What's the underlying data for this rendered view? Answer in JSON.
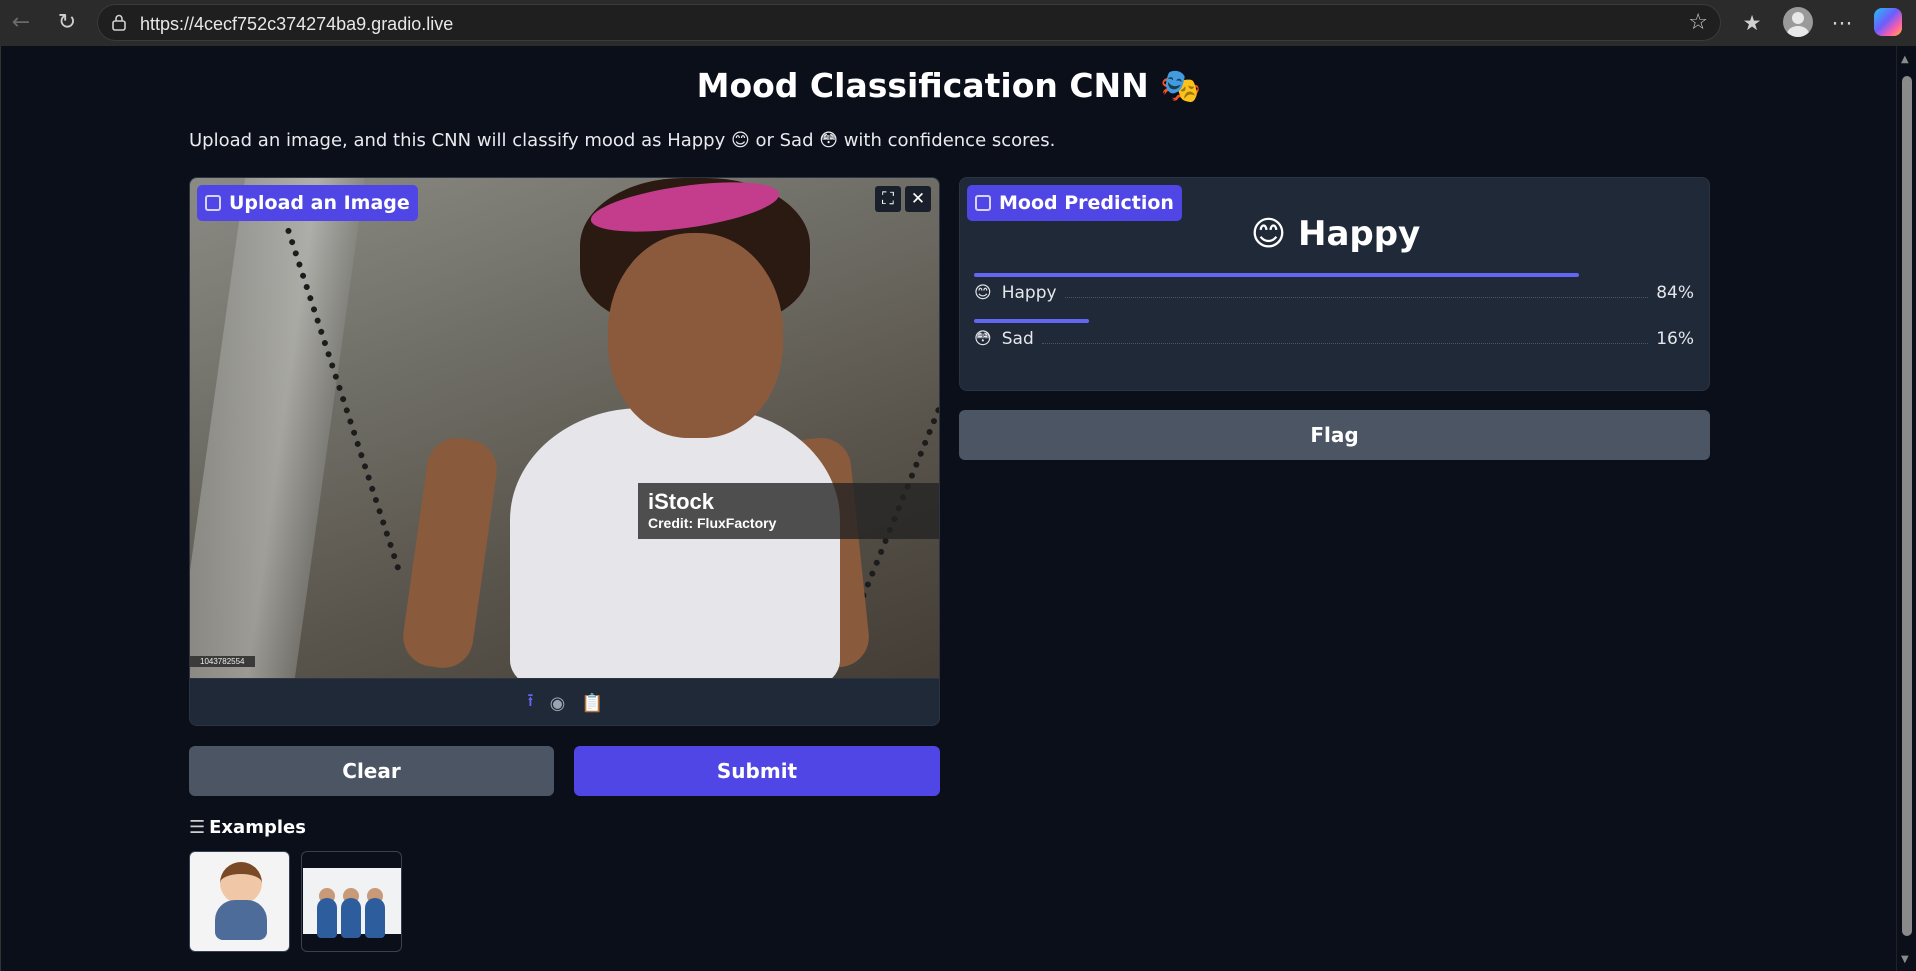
{
  "browser": {
    "url": "https://4cecf752c374274ba9.gradio.live",
    "back_icon": "arrow-left-icon",
    "reload_icon": "reload-icon"
  },
  "page": {
    "title": "Mood Classification CNN 🎭",
    "description": "Upload an image, and this CNN will classify mood as Happy 😊 or Sad 😳 with confidence scores."
  },
  "input": {
    "label": "Upload an Image",
    "watermark_brand": "iStock",
    "watermark_credit": "Credit: FluxFactory",
    "image_id": "1043782554",
    "source_icons": [
      "upload-icon",
      "webcam-icon",
      "clipboard-icon"
    ]
  },
  "buttons": {
    "clear": "Clear",
    "submit": "Submit",
    "flag": "Flag"
  },
  "examples": {
    "label": "Examples"
  },
  "output": {
    "label": "Mood Prediction",
    "top_prediction": "😊 Happy",
    "confidences": [
      {
        "emoji": "😊",
        "label": "Happy",
        "value": 0.84,
        "text": "84%"
      },
      {
        "emoji": "😳",
        "label": "Sad",
        "value": 0.16,
        "text": "16%"
      }
    ]
  },
  "colors": {
    "accent": "#4f46e5",
    "background": "#0b0f19",
    "panel": "#1f2937",
    "secondary_button": "#4b5563"
  }
}
